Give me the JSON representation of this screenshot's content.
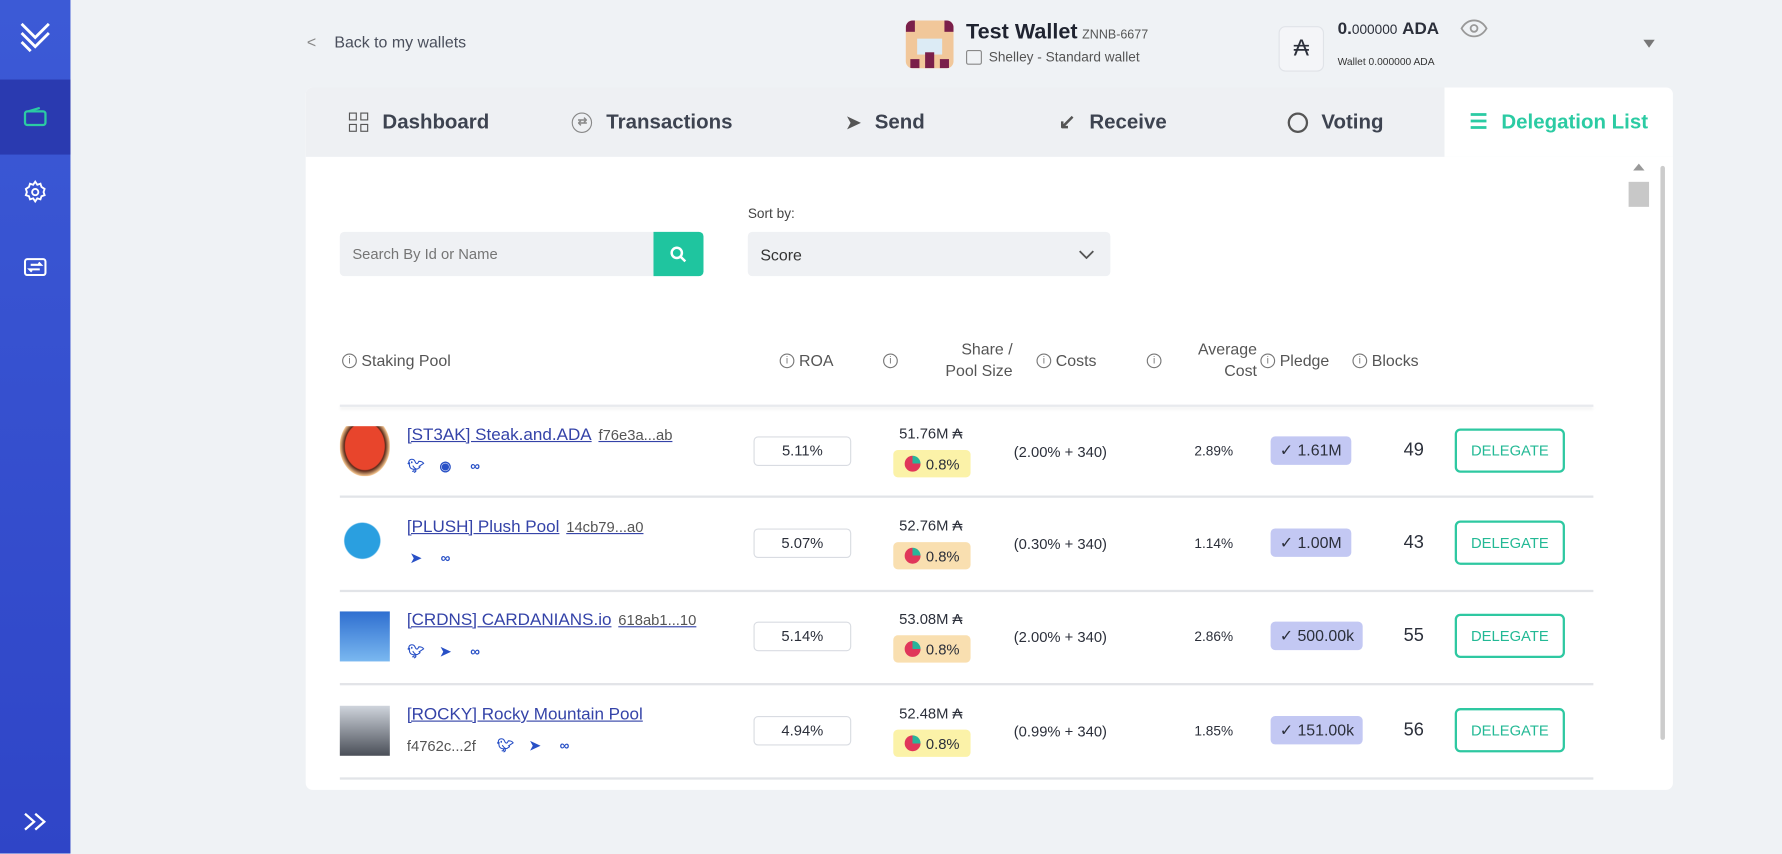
{
  "header": {
    "back_label": "Back to my wallets",
    "wallet_name": "Test Wallet",
    "wallet_id": "ZNNB-6677",
    "wallet_type": "Shelley - Standard wallet",
    "balance_int": "0.",
    "balance_dec": "000000",
    "balance_unit": "ADA",
    "wallet_balance": "Wallet 0.000000 ADA",
    "ada_symbol": "₳"
  },
  "tabs": [
    {
      "label": "Dashboard",
      "icon": "dashboard-icon"
    },
    {
      "label": "Transactions",
      "icon": "transactions-icon"
    },
    {
      "label": "Send",
      "icon": "send-icon"
    },
    {
      "label": "Receive",
      "icon": "receive-icon"
    },
    {
      "label": "Voting",
      "icon": "voting-icon"
    },
    {
      "label": "Delegation List",
      "icon": "list-icon"
    }
  ],
  "search": {
    "placeholder": "Search By Id or Name"
  },
  "sort": {
    "label": "Sort by:",
    "value": "Score"
  },
  "columns": {
    "pool": "Staking Pool",
    "roa": "ROA",
    "share1": "Share /",
    "share2": "Pool Size",
    "costs": "Costs",
    "avg1": "Average",
    "avg2": "Cost",
    "pledge": "Pledge",
    "blocks": "Blocks"
  },
  "rows": [
    {
      "name": "[ST3AK] Steak.and.ADA",
      "id": "f76e3a...ab",
      "roa": "5.11%",
      "size": "51.76M ₳",
      "share": "0.8%",
      "costs": "(2.00% + 340)",
      "avg": "2.89%",
      "pledge": "✓ 1.61M",
      "blocks": "49",
      "action": "DELEGATE",
      "share_color": "#fbf2a8"
    },
    {
      "name": "[PLUSH] Plush Pool",
      "id": "14cb79...a0",
      "roa": "5.07%",
      "size": "52.76M ₳",
      "share": "0.8%",
      "costs": "(0.30% + 340)",
      "avg": "1.14%",
      "pledge": "✓ 1.00M",
      "blocks": "43",
      "action": "DELEGATE",
      "share_color": "#f9dfb0"
    },
    {
      "name": "[CRDNS] CARDANIANS.io",
      "id": "618ab1...10",
      "roa": "5.14%",
      "size": "53.08M ₳",
      "share": "0.8%",
      "costs": "(2.00% + 340)",
      "avg": "2.86%",
      "pledge": "✓ 500.00k",
      "blocks": "55",
      "action": "DELEGATE",
      "share_color": "#f9dfb0"
    },
    {
      "name": "[ROCKY] Rocky Mountain Pool",
      "id": "f4762c...2f",
      "roa": "4.94%",
      "size": "52.48M ₳",
      "share": "0.8%",
      "costs": "(0.99% + 340)",
      "avg": "1.85%",
      "pledge": "✓ 151.00k",
      "blocks": "56",
      "action": "DELEGATE",
      "share_color": "#fbf2a8"
    }
  ],
  "colors": {
    "accent": "#1fc59f",
    "sidebar": "#3c5ad6",
    "link": "#3443a8"
  }
}
